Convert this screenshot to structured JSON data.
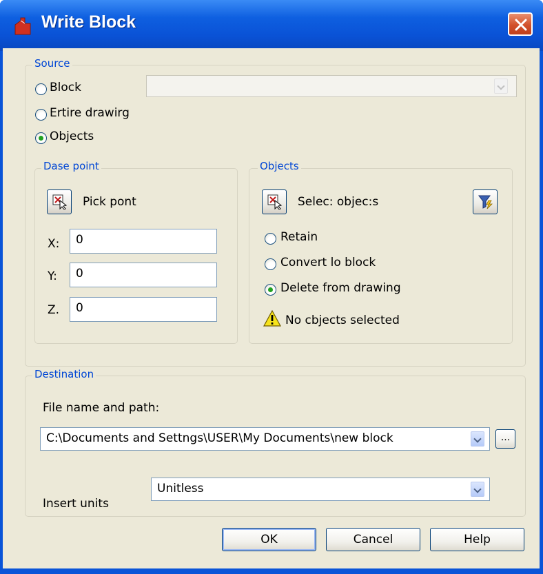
{
  "window": {
    "title": "Write Block",
    "close_icon": "close-icon"
  },
  "source": {
    "legend": "Source",
    "block_label": "Block",
    "entire_label": "Ertire drawirg",
    "objects_label": "Objects",
    "selected": "objects",
    "block_combo_value": ""
  },
  "base_point": {
    "legend": "Dase point",
    "pick_label": "Pick pont",
    "x_label": "X:",
    "x_value": "0",
    "y_label": "Y:",
    "y_value": "0",
    "z_label": "Z.",
    "z_value": "0"
  },
  "objects": {
    "legend": "Objects",
    "select_label": "Selec: objec:s",
    "retain_label": "Retain",
    "convert_label": "Convert lo block",
    "delete_label": "Delete from drawing",
    "selected": "delete",
    "warning_text": "No cbjects selected"
  },
  "destination": {
    "legend": "Destination",
    "file_label": "File name and path:",
    "file_value": "C:\\Documents and Settngs\\USER\\My Documents\\new block",
    "browse_label": "...",
    "units_label": "Insert units",
    "units_value": "Unitless"
  },
  "buttons": {
    "ok": "OK",
    "cancel": "Cancel",
    "help": "Help"
  },
  "colors": {
    "titlebar": "#0a54d8",
    "dialog_bg": "#ece9d8",
    "legend_text": "#0046d5",
    "close_button": "#d2502a"
  }
}
